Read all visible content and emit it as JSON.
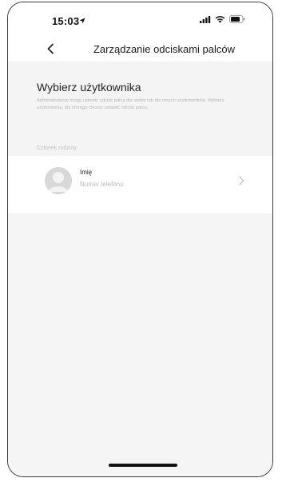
{
  "status_bar": {
    "time": "15:03",
    "location_icon": "location-arrow-icon",
    "signal_icon": "cellular-signal-icon",
    "wifi_icon": "wifi-icon",
    "battery_icon": "battery-icon"
  },
  "nav": {
    "back_icon": "chevron-left-icon",
    "title": "Zarządzanie odciskami palców"
  },
  "intro": {
    "title": "Wybierz użytkownika",
    "description": "Administratorzy mogą ustawić odcisk palca dla siebie lub dla innych użytkowników. Wybierz użytkownika, dla którego chcesz ustawić odcisk palca."
  },
  "section": {
    "label": "Członek rodziny"
  },
  "users": [
    {
      "name": "Imię",
      "phone": "Numer telefonu",
      "avatar_icon": "user-avatar-icon",
      "chevron_icon": "chevron-right-icon"
    }
  ],
  "colors": {
    "background": "#f5f5f5",
    "card": "#ffffff",
    "text_primary": "#222222",
    "text_secondary": "#b8b8b8"
  }
}
